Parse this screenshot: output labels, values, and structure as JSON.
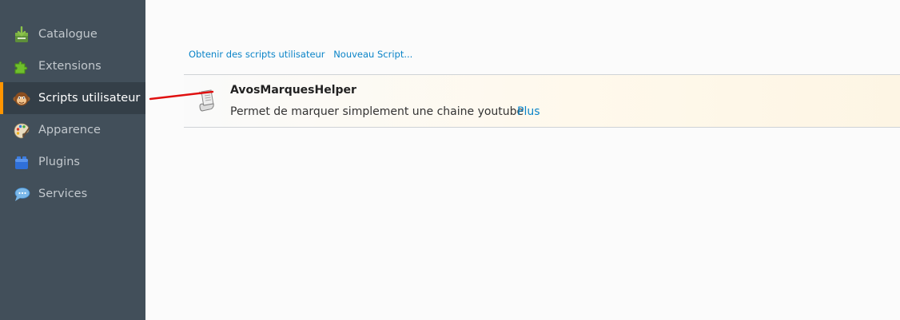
{
  "sidebar": {
    "items": [
      {
        "label": "Catalogue",
        "icon": "catalogue-icon",
        "selected": false
      },
      {
        "label": "Extensions",
        "icon": "puzzle-piece-icon",
        "selected": false
      },
      {
        "label": "Scripts utilisateur",
        "icon": "monkey-icon",
        "selected": true
      },
      {
        "label": "Apparence",
        "icon": "paint-palette-icon",
        "selected": false
      },
      {
        "label": "Plugins",
        "icon": "lego-brick-icon",
        "selected": false
      },
      {
        "label": "Services",
        "icon": "chat-bubble-icon",
        "selected": false
      }
    ]
  },
  "toolbar": {
    "get_scripts_label": "Obtenir des scripts utilisateur",
    "new_script_label": "Nouveau Script..."
  },
  "scripts": [
    {
      "name": "AvosMarquesHelper",
      "description": "Permet de marquer simplement une chaine youtube",
      "more_label": "Plus",
      "icon": "script-scroll-icon"
    }
  ],
  "colors": {
    "sidebar_bg": "#424f5a",
    "sidebar_selected_bg": "#343f48",
    "selected_accent": "#ff9500",
    "link": "#0a84c8",
    "annotation_arrow": "#e01010"
  }
}
